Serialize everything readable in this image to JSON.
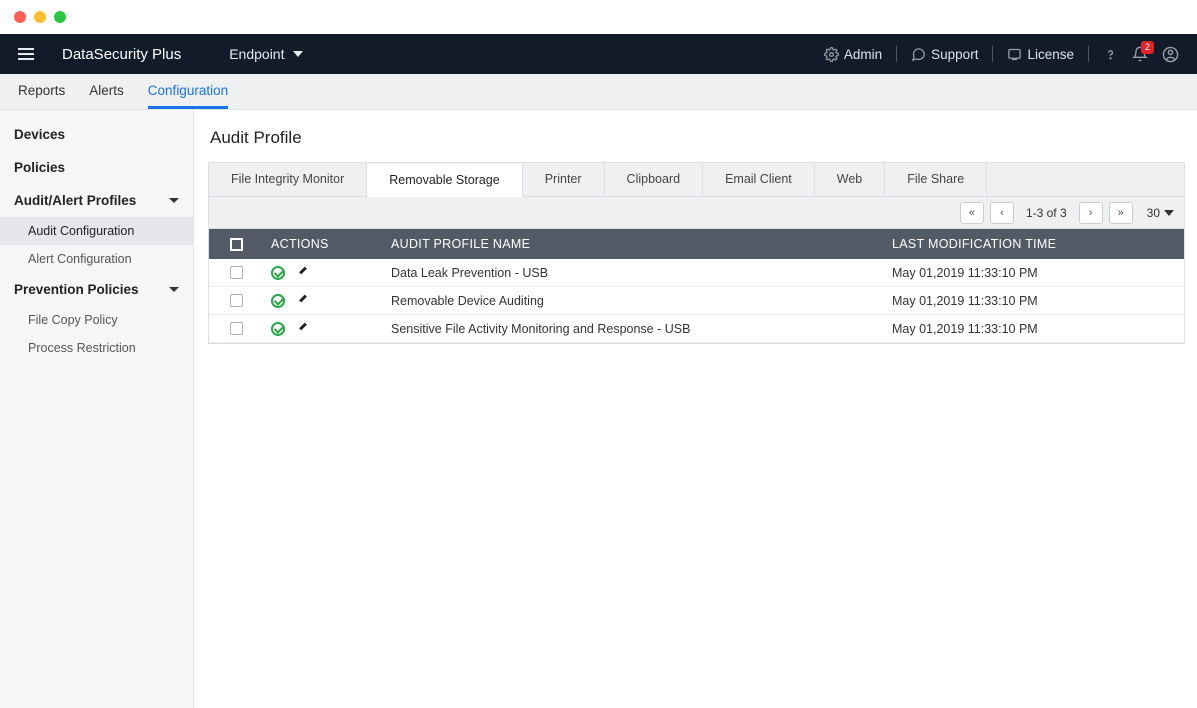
{
  "brand": "DataSecurity Plus",
  "module": "Endpoint",
  "topbar_right": {
    "admin": "Admin",
    "support": "Support",
    "license": "License",
    "badge": "2"
  },
  "subnav": {
    "reports": "Reports",
    "alerts": "Alerts",
    "configuration": "Configuration"
  },
  "sidebar": {
    "devices": "Devices",
    "policies": "Policies",
    "audit_alert": "Audit/Alert Profiles",
    "audit_config": "Audit Configuration",
    "alert_config": "Alert Configuration",
    "prevention": "Prevention Policies",
    "file_copy": "File Copy Policy",
    "process_restriction": "Process Restriction"
  },
  "page_title": "Audit Profile",
  "tabs": [
    "File Integrity Monitor",
    "Removable Storage",
    "Printer",
    "Clipboard",
    "Email Client",
    "Web",
    "File Share"
  ],
  "pager": {
    "range": "1-3 of 3",
    "size": "30"
  },
  "columns": {
    "actions": "ACTIONS",
    "name": "AUDIT PROFILE NAME",
    "modified": "LAST MODIFICATION TIME"
  },
  "rows": [
    {
      "name": "Data Leak Prevention - USB",
      "modified": "May 01,2019 11:33:10 PM"
    },
    {
      "name": "Removable Device Auditing",
      "modified": "May 01,2019 11:33:10 PM"
    },
    {
      "name": "Sensitive File Activity Monitoring and Response - USB",
      "modified": "May 01,2019 11:33:10 PM"
    }
  ]
}
